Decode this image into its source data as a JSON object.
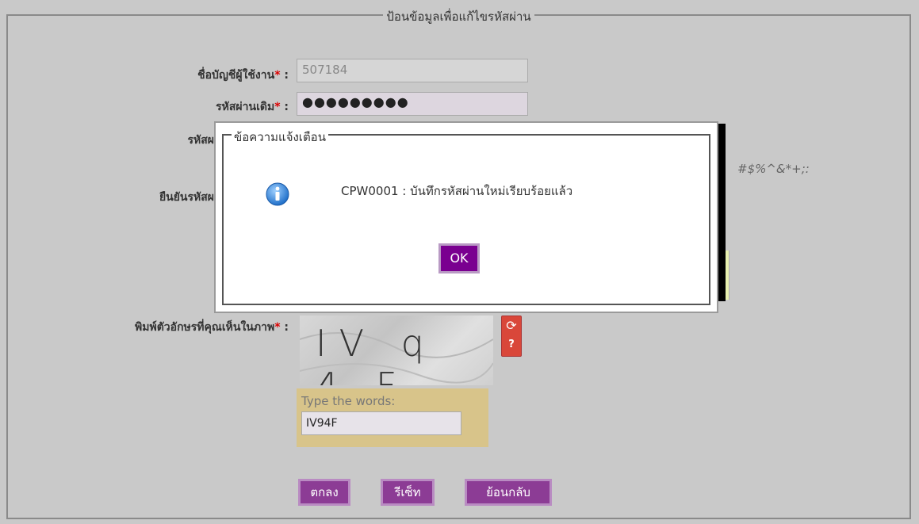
{
  "form": {
    "title": "ป้อนข้อมูลเพื่อแก้ไขรหัสผ่าน",
    "username_label": "ชื่อบัญชีผู้ใช้งาน",
    "username_value": "507184",
    "old_password_label": "รหัสผ่านเดิม",
    "old_password_value": "●●●●●●●●●",
    "new_password_label_partial": "รหัสผ",
    "confirm_label_partial": "ยืนยันรหัสผ",
    "hint_partial": "#$%^&*+;:",
    "captcha_label": "พิมพ์ตัวอักษรที่คุณเห็นในภาพ",
    "required_mark": "*",
    "colon": ":",
    "captcha_text": "IV q 4 F",
    "type_words_label": "Type the words:",
    "captcha_input": "IV94F"
  },
  "buttons": {
    "submit": "ตกลง",
    "reset": "รีเซ็ท",
    "back": "ย้อนกลับ"
  },
  "dialog": {
    "title": "ข้อความแจ้งเตือน",
    "message": "CPW0001 : บันทึกรหัสผ่านใหม่เรียบร้อยแล้ว",
    "ok": "OK"
  },
  "icons": {
    "info": "info-icon",
    "refresh": "refresh-icon",
    "help": "help-icon"
  },
  "colors": {
    "button_bg": "#8c3c95",
    "dialog_ok_bg": "#7a0090",
    "required": "#d00",
    "info_blue": "#2a7fd4"
  }
}
